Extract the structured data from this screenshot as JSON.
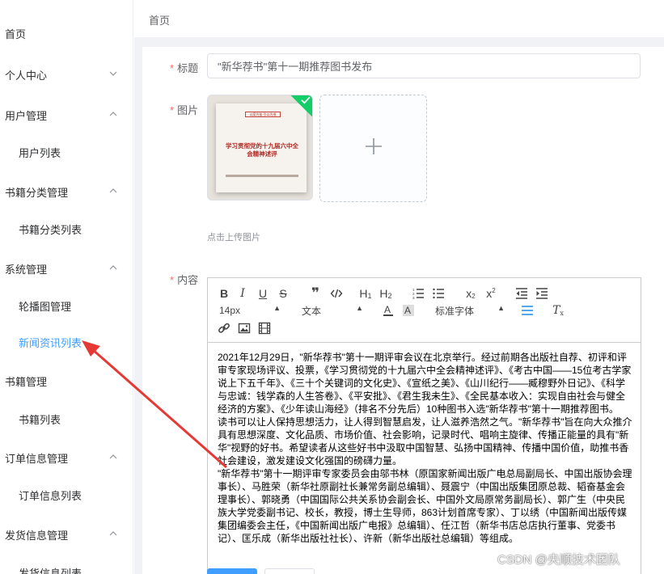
{
  "sidebar": {
    "home": "首页",
    "personal_center": "个人中心",
    "user_mgmt": "用户管理",
    "user_list": "用户列表",
    "book_cat_mgmt": "书籍分类管理",
    "book_cat_list": "书籍分类列表",
    "system_mgmt": "系统管理",
    "carousel_mgmt": "轮播图管理",
    "news_list": "新闻资讯列表",
    "book_mgmt": "书籍管理",
    "book_list": "书籍列表",
    "order_mgmt": "订单信息管理",
    "order_list": "订单信息列表",
    "shipping_mgmt": "发货信息管理",
    "shipping_list": "发货信息列表"
  },
  "header": {
    "breadcrumb": "首页"
  },
  "form": {
    "title_label": "标题",
    "title_value": "\"新华荐书\"第十一期推荐图书发布",
    "image_label": "图片",
    "upload_tip": "点击上传图片",
    "content_label": "内容"
  },
  "book_cover": {
    "band_text": "以案为鉴  引以为戒",
    "title": "学习贯彻党的十九届六中全会精神述评"
  },
  "editor": {
    "font_size": "14px",
    "text_style": "文本",
    "font_family": "标准字体",
    "paragraphs": [
      "2021年12月29日，\"新华荐书\"第十一期评审会议在北京举行。经过前期各出版社自荐、初评和评审专家现场评议、投票，《学习贯彻党的十九届六中全会精神述评》、《考古中国——15位考古学家说上下五千年》、《三十个关键词的文化史》、《宣纸之美》、《山川纪行——臧穆野外日记》、《科学与忠诚：钱学森的人生答卷》、《平安批》、《君生我未生》、《全民基本收入：实现自由社会与健全经济的方案》、《少年读山海经》（排名不分先后）10种图书入选\"新华荐书\"第十一期推荐图书。",
      "读书可以让人保持思想活力，让人得到智慧启发，让人滋养浩然之气。\"新华荐书\"旨在向大众推介具有思想深度、文化品质、市场价值、社会影响，记录时代、唱响主旋律、传播正能量的具有\"新华\"视野的好书。希望读者从这些好书中汲取中国智慧、弘扬中国精神、传播中国价值，助推书香社会建设，激发建设文化强国的磅礴力量。",
      "\"新华荐书\"第十一期评审专家委员会由邬书林（原国家新闻出版广电总局副局长、中国出版协会理事长）、马胜荣（新华社原副社长兼常务副总编辑）、聂震宁（中国出版集团原总裁、韬奋基金会理事长）、郭晓勇（中国国际公共关系协会副会长、中国外文局原常务副局长）、郭广生（中央民族大学党委副书记、校长，教授，博士生导师，863计划首席专家）、丁以绣（中国新闻出版传媒集团编委会主任，《中国新闻出版广电报》总编辑）、任江哲（新华书店总店执行董事、党委书记）、匡乐成（新华出版社社长）、许新（新华出版社总编辑）等组成。"
    ]
  },
  "watermark": "CSDN @央顺技术团队",
  "colors": {
    "accent": "#409eff",
    "required": "#f56c6c",
    "success": "#13ce66",
    "arrow": "#e53935"
  }
}
